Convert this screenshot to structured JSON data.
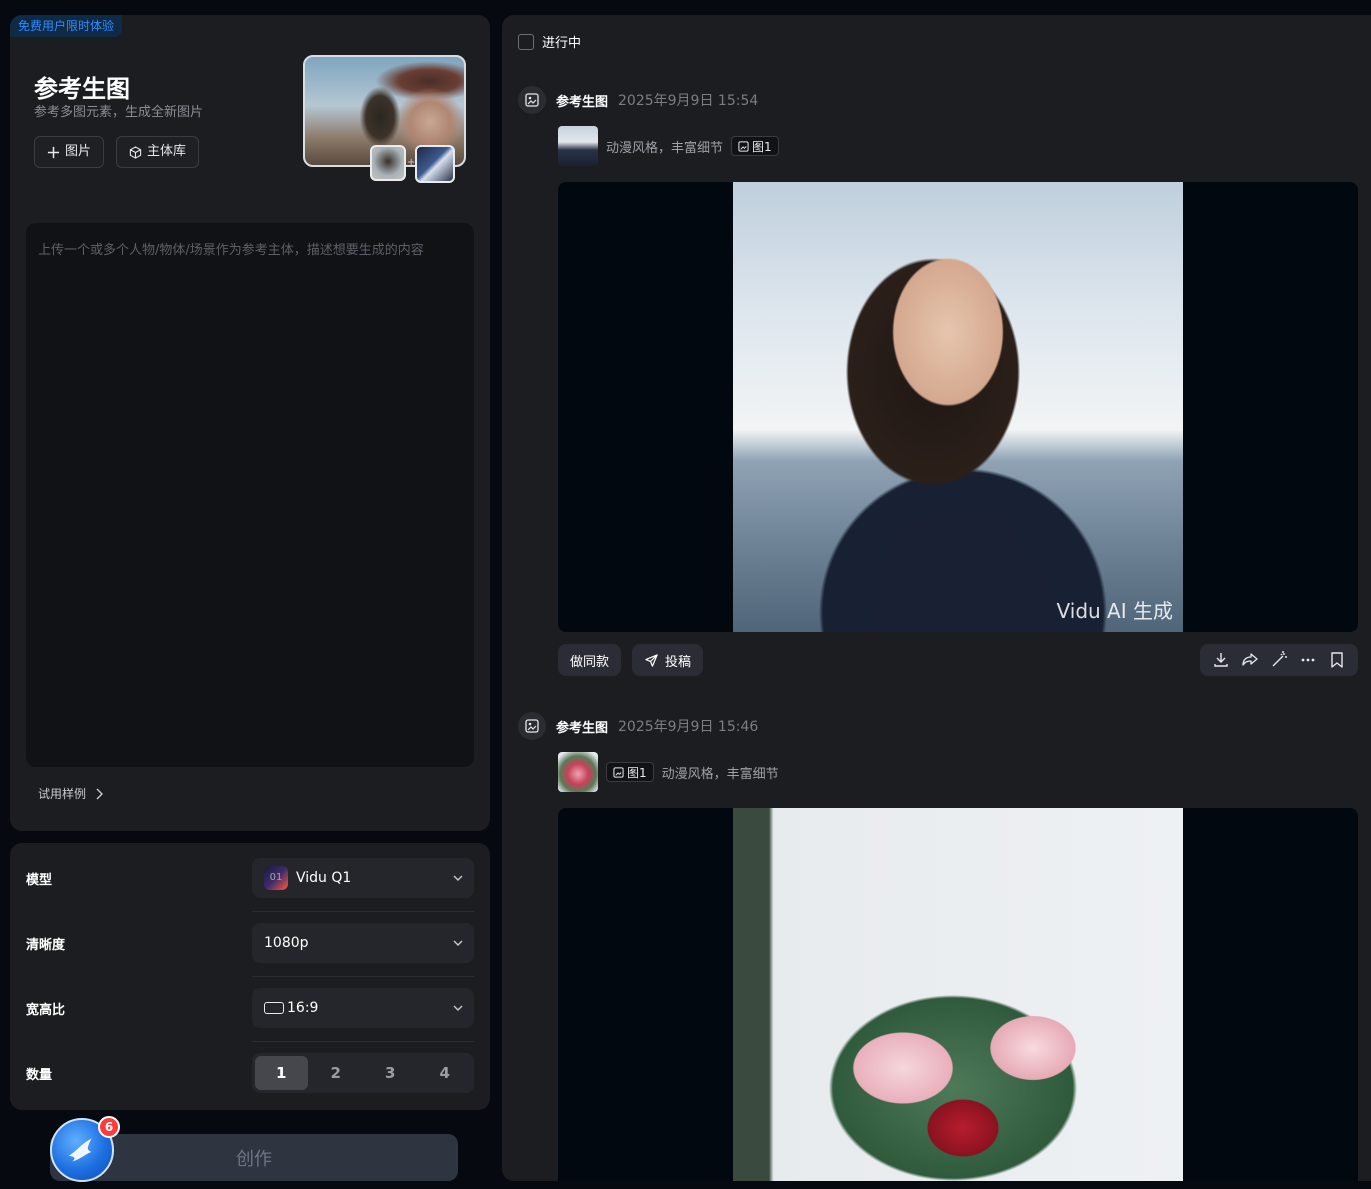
{
  "left": {
    "free_badge": "免费用户限时体验",
    "title": "参考生图",
    "subtitle": "参考多图元素，生成全新图片",
    "add_image_label": "图片",
    "subject_library_label": "主体库",
    "prompt_placeholder": "上传一个或多个人物/物体/场景作为参考主体，描述想要生成的内容",
    "try_examples_label": "试用样例"
  },
  "settings": {
    "model_label": "模型",
    "model_value": "Vidu Q1",
    "model_icon_text": "01",
    "resolution_label": "清晰度",
    "resolution_value": "1080p",
    "aspect_label": "宽高比",
    "aspect_value": "16:9",
    "quantity_label": "数量",
    "quantity_options": [
      "1",
      "2",
      "3",
      "4"
    ],
    "quantity_selected": "1"
  },
  "create_button": "创作",
  "assistant_badge": "6",
  "right": {
    "in_progress_label": "进行中",
    "tasks": [
      {
        "title": "参考生图",
        "time": "2025年9月9日 15:54",
        "prompt": "动漫风格，丰富细节",
        "tag": "图1",
        "watermark": "Vidu AI 生成",
        "same_style_label": "做同款",
        "submit_label": "投稿"
      },
      {
        "title": "参考生图",
        "time": "2025年9月9日 15:46",
        "prompt": "动漫风格，丰富细节",
        "tag": "图1"
      }
    ]
  },
  "colors": {
    "page_bg": "#060a10",
    "panel_bg": "#1c1d21",
    "accent_blue": "#2f8cff",
    "badge_red": "#ff3b3b"
  }
}
